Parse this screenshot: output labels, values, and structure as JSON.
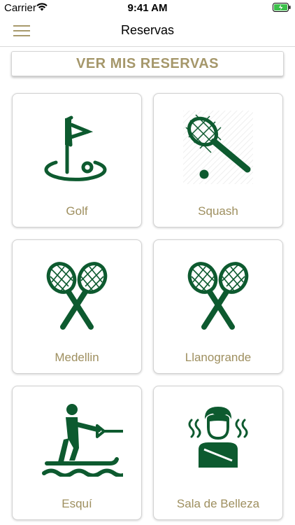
{
  "status_bar": {
    "carrier": "Carrier",
    "time": "9:41 AM"
  },
  "nav": {
    "title": "Reservas"
  },
  "my_reservations_button": "VER MIS RESERVAS",
  "colors": {
    "icon_green": "#0d5a2f",
    "label_gold": "#9e8f5f",
    "header_gold": "#a5976a"
  },
  "cards": [
    {
      "label": "Golf",
      "icon": "golf-flag-icon"
    },
    {
      "label": "Squash",
      "icon": "squash-racket-icon"
    },
    {
      "label": "Medellin",
      "icon": "crossed-rackets-icon"
    },
    {
      "label": "Llanogrande",
      "icon": "crossed-rackets-icon"
    },
    {
      "label": "Esquí",
      "icon": "water-ski-icon"
    },
    {
      "label": "Sala de Belleza",
      "icon": "beauty-salon-icon"
    }
  ]
}
